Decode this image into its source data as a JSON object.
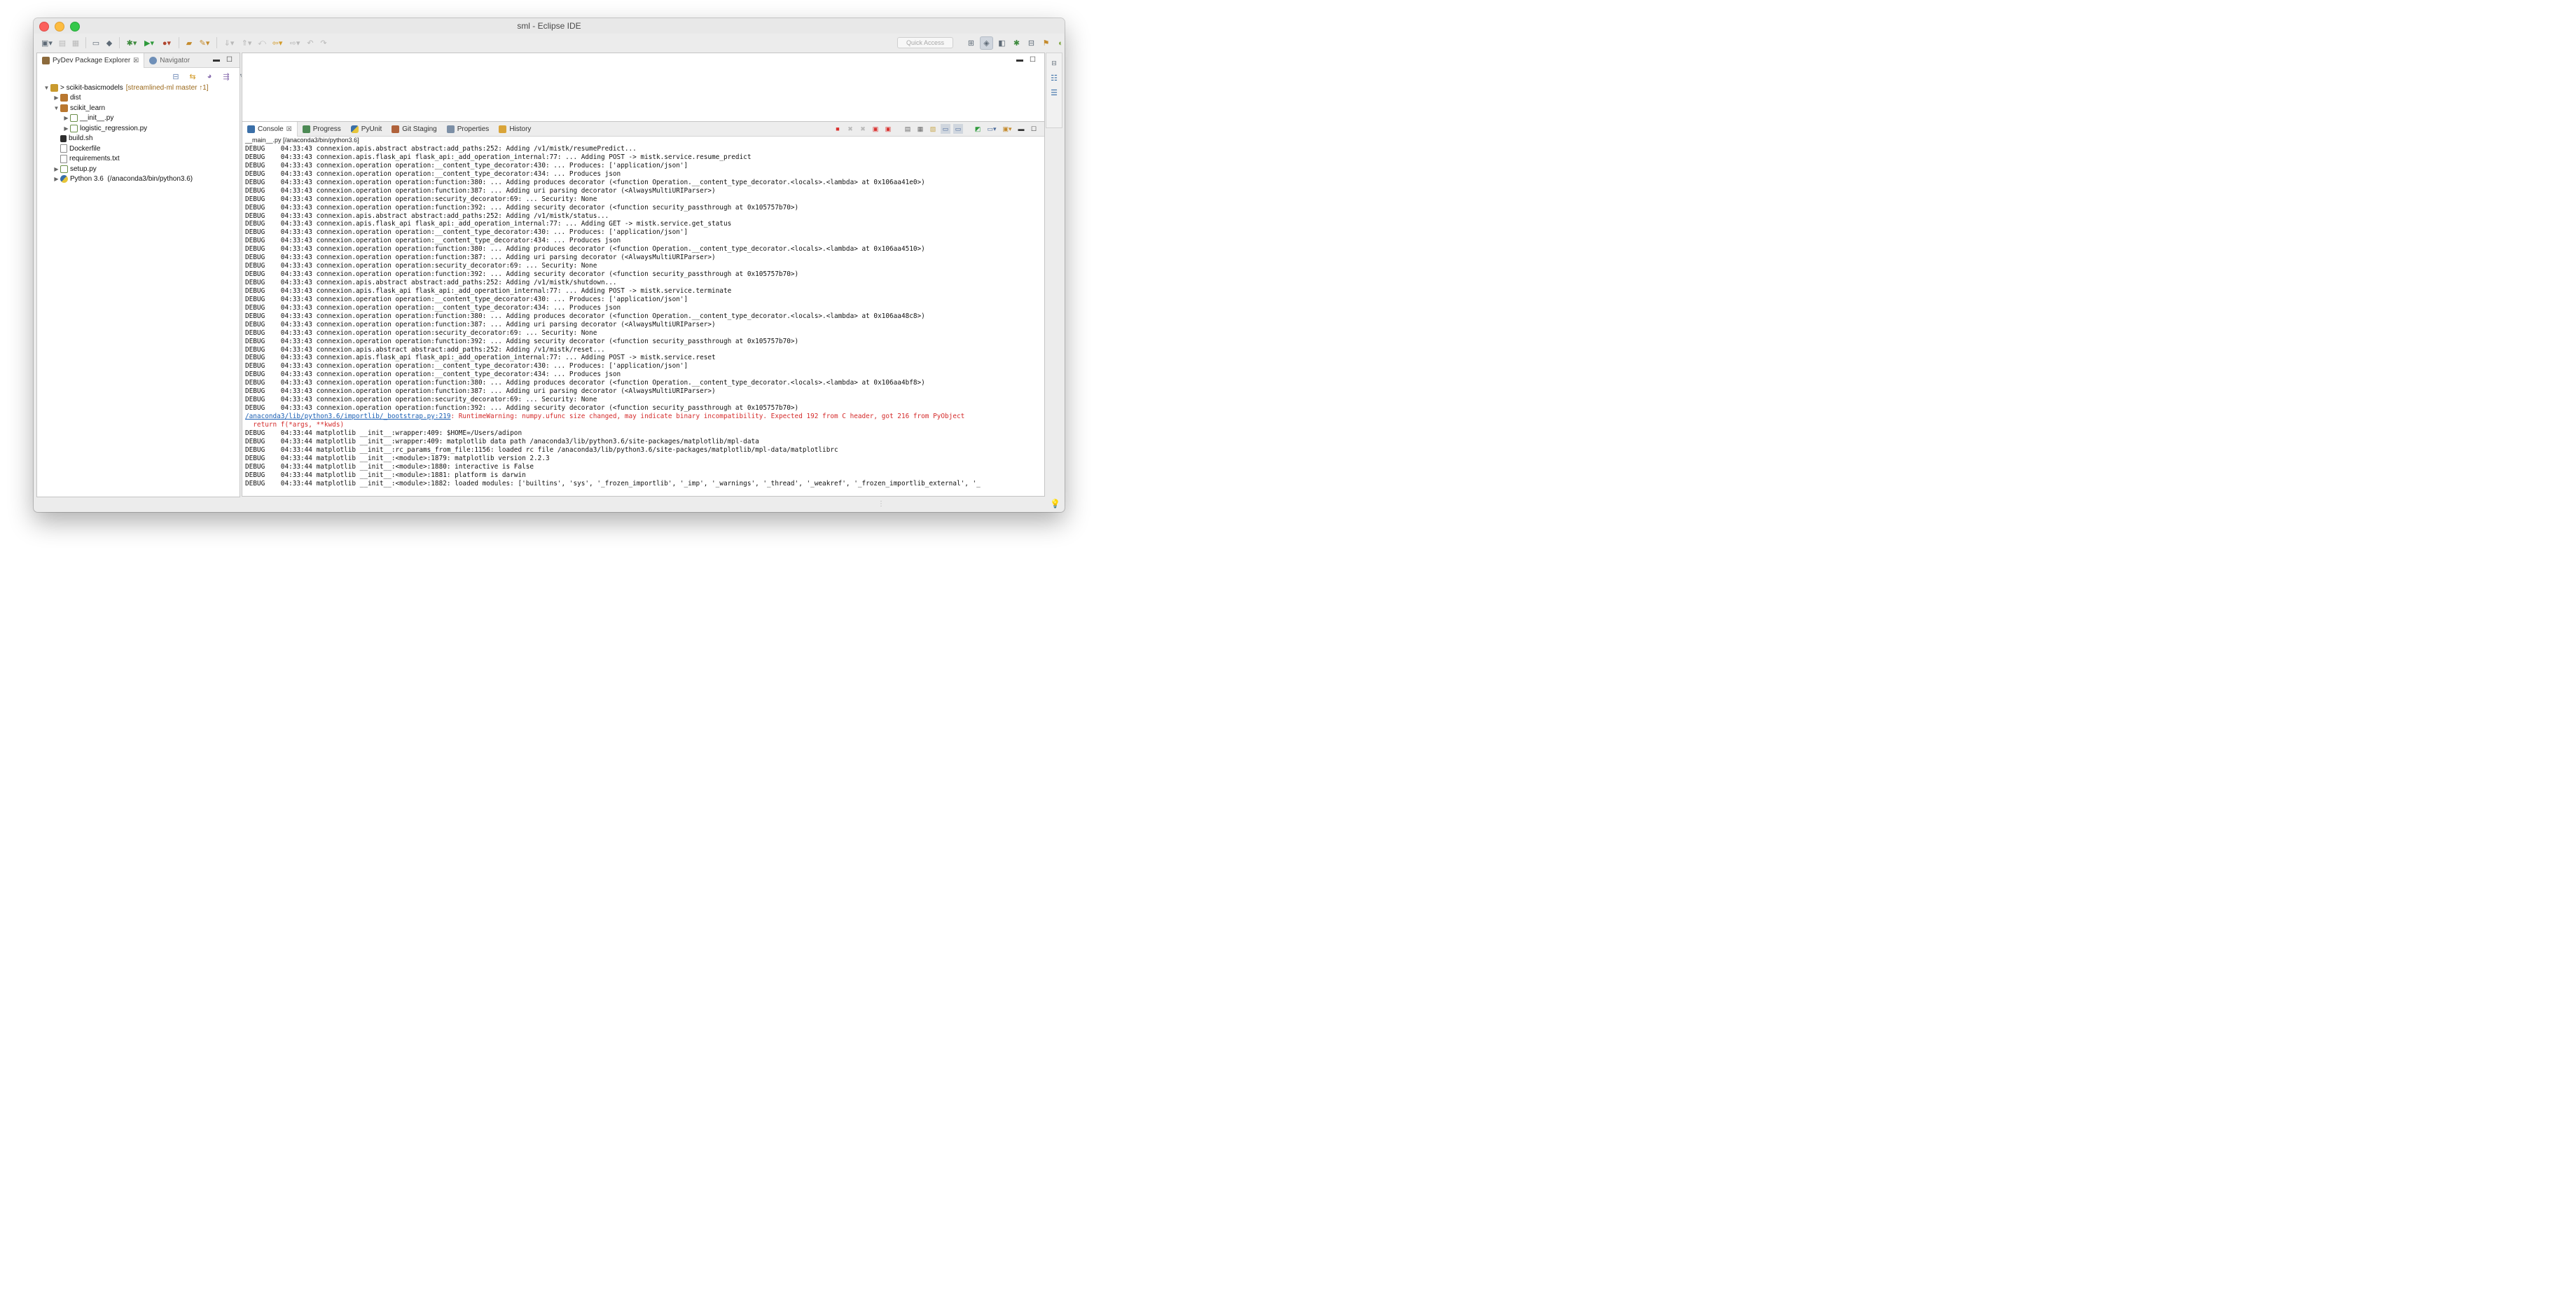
{
  "window": {
    "title": "sml - Eclipse IDE"
  },
  "quick_access": {
    "placeholder": "Quick Access"
  },
  "explorer": {
    "tabs": [
      {
        "label": "PyDev Package Explorer",
        "close": "☒"
      },
      {
        "label": "Navigator"
      }
    ],
    "tree": [
      {
        "indent": 0,
        "twisty": "▼",
        "icon": "project",
        "prefix": "> ",
        "label": "scikit-basicmodels",
        "decoration": "[streamlined-ml master ↑1]"
      },
      {
        "indent": 1,
        "twisty": "▶",
        "icon": "package",
        "label": "dist"
      },
      {
        "indent": 1,
        "twisty": "▼",
        "icon": "package",
        "label": "scikit_learn"
      },
      {
        "indent": 2,
        "twisty": "▶",
        "icon": "py-file",
        "label": "__init__.py"
      },
      {
        "indent": 2,
        "twisty": "▶",
        "icon": "py-file",
        "label": "logistic_regression.py"
      },
      {
        "indent": 1,
        "twisty": "",
        "icon": "shell-file",
        "label": "build.sh"
      },
      {
        "indent": 1,
        "twisty": "",
        "icon": "file",
        "label": "Dockerfile"
      },
      {
        "indent": 1,
        "twisty": "",
        "icon": "file",
        "label": "requirements.txt"
      },
      {
        "indent": 1,
        "twisty": "▶",
        "icon": "py-file",
        "label": "setup.py"
      },
      {
        "indent": 1,
        "twisty": "▶",
        "icon": "interpreter",
        "label": "Python 3.6  (/anaconda3/bin/python3.6)"
      }
    ]
  },
  "console": {
    "tabs": [
      {
        "label": "Console",
        "close": "☒"
      },
      {
        "label": "Progress"
      },
      {
        "label": "PyUnit"
      },
      {
        "label": "Git Staging"
      },
      {
        "label": "Properties"
      },
      {
        "label": "History"
      }
    ],
    "path": "__main__.py [/anaconda3/bin/python3.6]",
    "lines": [
      {
        "text": "DEBUG    04:33:43 connexion.apis.abstract abstract:add_paths:252: Adding /v1/mistk/resumePredict..."
      },
      {
        "text": "DEBUG    04:33:43 connexion.apis.flask_api flask_api:_add_operation_internal:77: ... Adding POST -> mistk.service.resume_predict"
      },
      {
        "text": "DEBUG    04:33:43 connexion.operation operation:__content_type_decorator:430: ... Produces: ['application/json']"
      },
      {
        "text": "DEBUG    04:33:43 connexion.operation operation:__content_type_decorator:434: ... Produces json"
      },
      {
        "text": "DEBUG    04:33:43 connexion.operation operation:function:380: ... Adding produces decorator (<function Operation.__content_type_decorator.<locals>.<lambda> at 0x106aa41e0>)"
      },
      {
        "text": "DEBUG    04:33:43 connexion.operation operation:function:387: ... Adding uri parsing decorator (<AlwaysMultiURIParser>)"
      },
      {
        "text": "DEBUG    04:33:43 connexion.operation operation:security_decorator:69: ... Security: None"
      },
      {
        "text": "DEBUG    04:33:43 connexion.operation operation:function:392: ... Adding security decorator (<function security_passthrough at 0x105757b70>)"
      },
      {
        "text": "DEBUG    04:33:43 connexion.apis.abstract abstract:add_paths:252: Adding /v1/mistk/status..."
      },
      {
        "text": "DEBUG    04:33:43 connexion.apis.flask_api flask_api:_add_operation_internal:77: ... Adding GET -> mistk.service.get_status"
      },
      {
        "text": "DEBUG    04:33:43 connexion.operation operation:__content_type_decorator:430: ... Produces: ['application/json']"
      },
      {
        "text": "DEBUG    04:33:43 connexion.operation operation:__content_type_decorator:434: ... Produces json"
      },
      {
        "text": "DEBUG    04:33:43 connexion.operation operation:function:380: ... Adding produces decorator (<function Operation.__content_type_decorator.<locals>.<lambda> at 0x106aa4510>)"
      },
      {
        "text": "DEBUG    04:33:43 connexion.operation operation:function:387: ... Adding uri parsing decorator (<AlwaysMultiURIParser>)"
      },
      {
        "text": "DEBUG    04:33:43 connexion.operation operation:security_decorator:69: ... Security: None"
      },
      {
        "text": "DEBUG    04:33:43 connexion.operation operation:function:392: ... Adding security decorator (<function security_passthrough at 0x105757b70>)"
      },
      {
        "text": "DEBUG    04:33:43 connexion.apis.abstract abstract:add_paths:252: Adding /v1/mistk/shutdown..."
      },
      {
        "text": "DEBUG    04:33:43 connexion.apis.flask_api flask_api:_add_operation_internal:77: ... Adding POST -> mistk.service.terminate"
      },
      {
        "text": "DEBUG    04:33:43 connexion.operation operation:__content_type_decorator:430: ... Produces: ['application/json']"
      },
      {
        "text": "DEBUG    04:33:43 connexion.operation operation:__content_type_decorator:434: ... Produces json"
      },
      {
        "text": "DEBUG    04:33:43 connexion.operation operation:function:380: ... Adding produces decorator (<function Operation.__content_type_decorator.<locals>.<lambda> at 0x106aa48c8>)"
      },
      {
        "text": "DEBUG    04:33:43 connexion.operation operation:function:387: ... Adding uri parsing decorator (<AlwaysMultiURIParser>)"
      },
      {
        "text": "DEBUG    04:33:43 connexion.operation operation:security_decorator:69: ... Security: None"
      },
      {
        "text": "DEBUG    04:33:43 connexion.operation operation:function:392: ... Adding security decorator (<function security_passthrough at 0x105757b70>)"
      },
      {
        "text": "DEBUG    04:33:43 connexion.apis.abstract abstract:add_paths:252: Adding /v1/mistk/reset..."
      },
      {
        "text": "DEBUG    04:33:43 connexion.apis.flask_api flask_api:_add_operation_internal:77: ... Adding POST -> mistk.service.reset"
      },
      {
        "text": "DEBUG    04:33:43 connexion.operation operation:__content_type_decorator:430: ... Produces: ['application/json']"
      },
      {
        "text": "DEBUG    04:33:43 connexion.operation operation:__content_type_decorator:434: ... Produces json"
      },
      {
        "text": "DEBUG    04:33:43 connexion.operation operation:function:380: ... Adding produces decorator (<function Operation.__content_type_decorator.<locals>.<lambda> at 0x106aa4bf8>)"
      },
      {
        "text": "DEBUG    04:33:43 connexion.operation operation:function:387: ... Adding uri parsing decorator (<AlwaysMultiURIParser>)"
      },
      {
        "text": "DEBUG    04:33:43 connexion.operation operation:security_decorator:69: ... Security: None"
      },
      {
        "text": "DEBUG    04:33:43 connexion.operation operation:function:392: ... Adding security decorator (<function security_passthrough at 0x105757b70>)"
      },
      {
        "link": "/anaconda3/lib/python3.6/importlib/_bootstrap.py:219",
        "text": ": RuntimeWarning: numpy.ufunc size changed, may indicate binary incompatibility. Expected 192 from C header, got 216 from PyObject",
        "kind": "err"
      },
      {
        "text": "  return f(*args, **kwds)",
        "kind": "err"
      },
      {
        "text": "DEBUG    04:33:44 matplotlib __init__:wrapper:409: $HOME=/Users/adipon"
      },
      {
        "text": "DEBUG    04:33:44 matplotlib __init__:wrapper:409: matplotlib data path /anaconda3/lib/python3.6/site-packages/matplotlib/mpl-data"
      },
      {
        "text": "DEBUG    04:33:44 matplotlib __init__:rc_params_from_file:1156: loaded rc file /anaconda3/lib/python3.6/site-packages/matplotlib/mpl-data/matplotlibrc"
      },
      {
        "text": "DEBUG    04:33:44 matplotlib __init__:<module>:1879: matplotlib version 2.2.3"
      },
      {
        "text": "DEBUG    04:33:44 matplotlib __init__:<module>:1880: interactive is False"
      },
      {
        "text": "DEBUG    04:33:44 matplotlib __init__:<module>:1881: platform is darwin"
      },
      {
        "text": "DEBUG    04:33:44 matplotlib __init__:<module>:1882: loaded modules: ['builtins', 'sys', '_frozen_importlib', '_imp', '_warnings', '_thread', '_weakref', '_frozen_importlib_external', '_"
      }
    ]
  },
  "colors": {
    "error": "#d42a2a",
    "link": "#1a5fb4",
    "terminate": "#d9302e"
  }
}
